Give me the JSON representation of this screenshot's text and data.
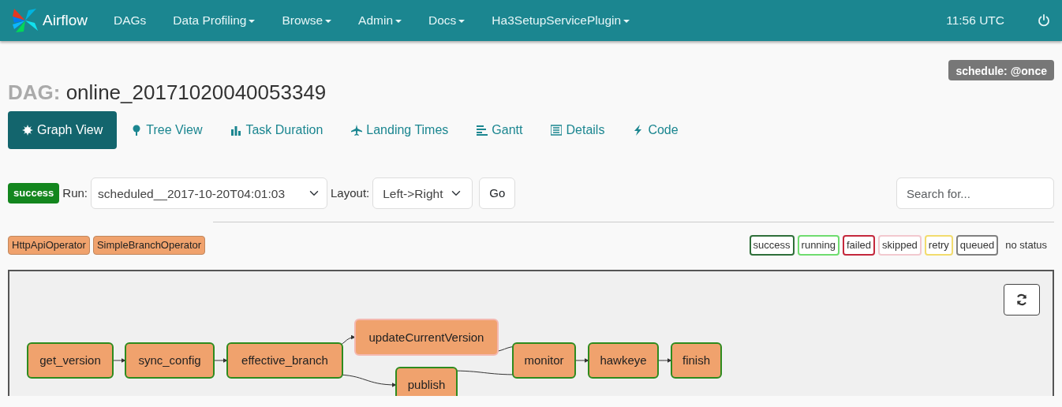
{
  "navbar": {
    "brand": "Airflow",
    "items": [
      {
        "label": "DAGs",
        "dropdown": false
      },
      {
        "label": "Data Profiling",
        "dropdown": true
      },
      {
        "label": "Browse",
        "dropdown": true
      },
      {
        "label": "Admin",
        "dropdown": true
      },
      {
        "label": "Docs",
        "dropdown": true
      },
      {
        "label": "Ha3SetupServicePlugin",
        "dropdown": true
      }
    ],
    "clock": "11:56 UTC"
  },
  "dag": {
    "prefix": "DAG:",
    "name": "online_20171020040053349",
    "schedule": "schedule: @once"
  },
  "tabs": [
    {
      "label": "Graph View",
      "selected": true
    },
    {
      "label": "Tree View",
      "selected": false
    },
    {
      "label": "Task Duration",
      "selected": false
    },
    {
      "label": "Landing Times",
      "selected": false
    },
    {
      "label": "Gantt",
      "selected": false
    },
    {
      "label": "Details",
      "selected": false
    },
    {
      "label": "Code",
      "selected": false
    }
  ],
  "controls": {
    "state": "success",
    "run_label": "Run:",
    "run": "scheduled__2017-10-20T04:01:03",
    "layout_label": "Layout:",
    "layout": "Left->Right",
    "go": "Go",
    "search_placeholder": "Search for..."
  },
  "operators": [
    "HttpApiOperator",
    "SimpleBranchOperator"
  ],
  "legend": [
    {
      "label": "success",
      "color": "#2f6f3a"
    },
    {
      "label": "running",
      "color": "#6fdc6f"
    },
    {
      "label": "failed",
      "color": "#c4283c"
    },
    {
      "label": "skipped",
      "color": "#f2c9cf"
    },
    {
      "label": "retry",
      "color": "#f2dc6e"
    },
    {
      "label": "queued",
      "color": "#808080"
    },
    {
      "label": "no status"
    }
  ],
  "graph": {
    "nodes": [
      {
        "label": "get_version",
        "color": "#2e8b1e"
      },
      {
        "label": "sync_config",
        "color": "#2e8b1e"
      },
      {
        "label": "effective_branch",
        "color": "#2e8b1e"
      },
      {
        "label": "updateCurrentVersion",
        "color": "#f4b8b0"
      },
      {
        "label": "publish",
        "color": "#2e8b1e"
      },
      {
        "label": "monitor",
        "color": "#2e8b1e"
      },
      {
        "label": "hawkeye",
        "color": "#2e8b1e"
      },
      {
        "label": "finish",
        "color": "#2e8b1e"
      }
    ]
  }
}
